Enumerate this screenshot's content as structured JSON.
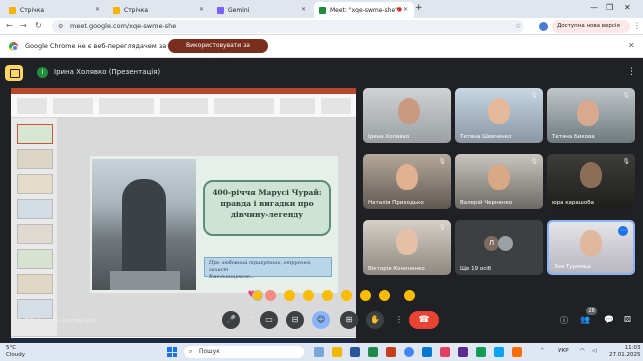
{
  "browser": {
    "tabs": [
      {
        "label": "Стрічка",
        "active": false
      },
      {
        "label": "Стрічка",
        "active": false
      },
      {
        "label": "Gemini",
        "active": false
      },
      {
        "label": "Meet: \"xqe-swme-she\"",
        "active": true
      }
    ],
    "new_tab": "+",
    "url": "meet.google.com/xqe-swme-she",
    "update_label": "Доступна нова версія Chrome"
  },
  "infobar": {
    "message": "Google Chrome не є веб-переглядачем за умовчанням",
    "button": "Використовувати за умовчанням"
  },
  "meet": {
    "presenter_initial": "І",
    "presenter_label": "Ірина Холявко (Презентація)",
    "slide": {
      "title_lines": [
        "400-річчя Марусі Чурай:",
        "правда і вигадки про",
        "дівчину-легенду"
      ],
      "quote_lines": [
        "Про любовний трикутник, отруєння, захист",
        "Хмельницького..."
      ]
    },
    "participants": [
      {
        "name": "Ірина Холявко",
        "muted": false,
        "speaking": false
      },
      {
        "name": "Тетяна Шевченко",
        "muted": true,
        "speaking": false
      },
      {
        "name": "Тетяна Бикова",
        "muted": true,
        "speaking": false
      },
      {
        "name": "Наталія Приходько",
        "muted": true,
        "speaking": false
      },
      {
        "name": "Валерій Черненко",
        "muted": true,
        "speaking": false
      },
      {
        "name": "юра карашоба",
        "muted": true,
        "speaking": false
      },
      {
        "name": "Вікторія Кононенко",
        "muted": true,
        "speaking": false
      },
      {
        "name": "Ще 19 осіб",
        "muted": false,
        "speaking": false
      },
      {
        "name": "Зоя Турмица",
        "muted": false,
        "speaking": true
      }
    ],
    "more_initial": "Л",
    "time": "11:03",
    "meeting_code": "xqe-swme-she",
    "people_count": "28"
  },
  "taskbar": {
    "temperature": "5°C",
    "weather": "Cloudy",
    "search_placeholder": "Пошук",
    "language": "УКР",
    "time": "11:03",
    "date": "27.01.2025"
  }
}
